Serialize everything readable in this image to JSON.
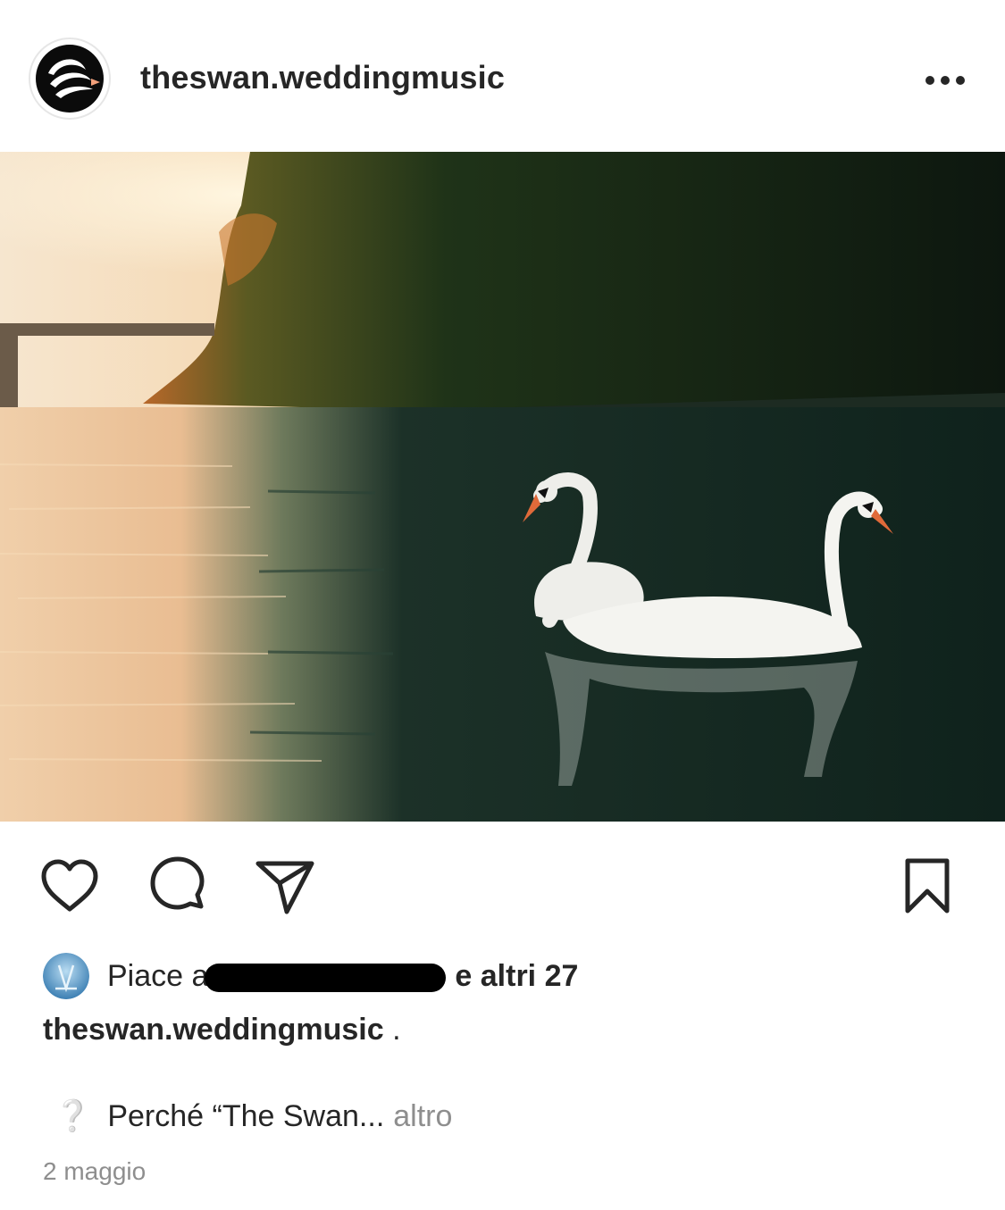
{
  "post": {
    "username": "theswan.weddingmusic",
    "more_icon": "more-horizontal-icon",
    "photo_alt": "two-swans-lake-sunset",
    "actions": {
      "like_icon": "heart-icon",
      "comment_icon": "comment-icon",
      "share_icon": "send-icon",
      "save_icon": "bookmark-icon"
    },
    "likes": {
      "prefix": "Piace a",
      "suffix": "e altri 27"
    },
    "caption": {
      "username": "theswan.weddingmusic",
      "text": "."
    },
    "snippet": {
      "icon": "❔",
      "text": "Perché “The Swan...",
      "more": "altro"
    },
    "date": "2 maggio"
  }
}
